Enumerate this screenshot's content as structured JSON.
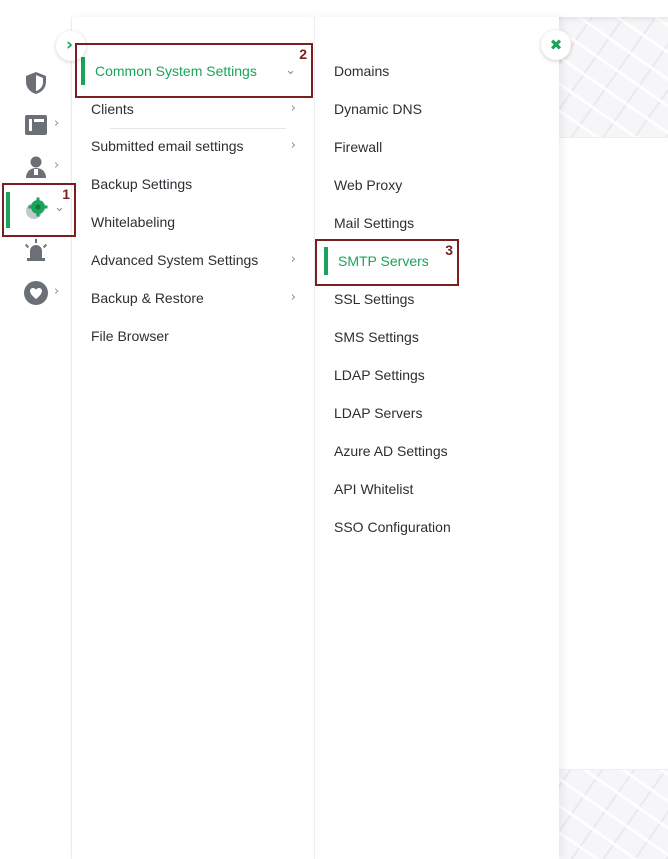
{
  "colors": {
    "accent": "#1aa35a",
    "annotation": "#7a1f1f",
    "text": "#2b2f33"
  },
  "rail": {
    "items": [
      {
        "icon": "shield-icon",
        "has_chevron": false
      },
      {
        "icon": "dashboard-icon",
        "has_chevron": true,
        "chevron": "›"
      },
      {
        "icon": "users-icon",
        "has_chevron": true,
        "chevron": "›"
      },
      {
        "icon": "gear-icon",
        "has_chevron": true,
        "chevron": "⌄",
        "active": true
      },
      {
        "icon": "alarm-icon",
        "has_chevron": false
      },
      {
        "icon": "heart-icon",
        "has_chevron": true,
        "chevron": "›"
      }
    ],
    "collapse_glyph": "›"
  },
  "panel1": {
    "items": [
      {
        "label": "Common System Settings",
        "arrow": "⌄",
        "active": true
      },
      {
        "label": "Clients",
        "arrow": "›"
      },
      {
        "label": "Submitted email settings",
        "arrow": "›"
      },
      {
        "label": "Backup Settings",
        "arrow": ""
      },
      {
        "label": "Whitelabeling",
        "arrow": ""
      },
      {
        "label": "Advanced System Settings",
        "arrow": "›"
      },
      {
        "label": "Backup & Restore",
        "arrow": "›"
      },
      {
        "label": "File Browser",
        "arrow": ""
      }
    ]
  },
  "panel2": {
    "close_glyph": "✖",
    "items": [
      {
        "label": "Domains"
      },
      {
        "label": "Dynamic DNS"
      },
      {
        "label": "Firewall"
      },
      {
        "label": "Web Proxy"
      },
      {
        "label": "Mail Settings"
      },
      {
        "label": "SMTP Servers",
        "active": true
      },
      {
        "label": "SSL Settings"
      },
      {
        "label": "SMS Settings"
      },
      {
        "label": "LDAP Settings"
      },
      {
        "label": "LDAP Servers"
      },
      {
        "label": "Azure AD Settings"
      },
      {
        "label": "API Whitelist"
      },
      {
        "label": "SSO Configuration"
      }
    ]
  },
  "annotations": [
    "1",
    "2",
    "3"
  ]
}
